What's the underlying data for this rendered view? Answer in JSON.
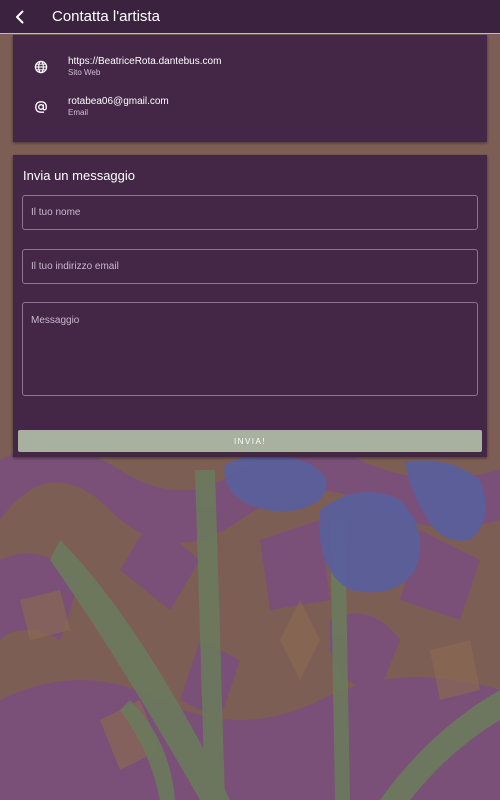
{
  "appbar": {
    "title": "Contatta l'artista",
    "back_icon": "arrow-back-icon"
  },
  "contacts": [
    {
      "icon": "globe-icon",
      "value": "https://BeatriceRota.dantebus.com",
      "label": "Sito Web"
    },
    {
      "icon": "at-icon",
      "value": "rotabea06@gmail.com",
      "label": "Email"
    }
  ],
  "form": {
    "title": "Invia un messaggio",
    "name_placeholder": "Il tuo nome",
    "email_placeholder": "Il tuo indirizzo email",
    "message_placeholder": "Messaggio",
    "send_label": "INVIA!"
  },
  "colors": {
    "appbar": "#3b2340",
    "card": "#442647",
    "button": "#a8b09f",
    "background_tint": "#7a5a54"
  }
}
